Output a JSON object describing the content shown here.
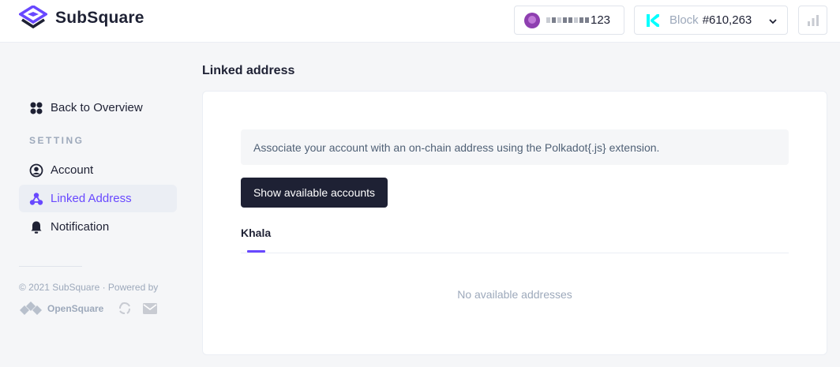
{
  "header": {
    "logo_text": "SubSquare",
    "account": {
      "address_suffix": "123"
    },
    "block": {
      "label": "Block",
      "number": "#610,263"
    }
  },
  "sidebar": {
    "back_label": "Back to Overview",
    "section_label": "SETTING",
    "items": [
      {
        "label": "Account",
        "icon": "user-circle-icon",
        "active": false
      },
      {
        "label": "Linked Address",
        "icon": "linked-nodes-icon",
        "active": true
      },
      {
        "label": "Notification",
        "icon": "bell-icon",
        "active": false
      }
    ],
    "footer_text": "© 2021 SubSquare · Powered by",
    "powered_by": "OpenSquare"
  },
  "main": {
    "title": "Linked address",
    "info_text": "Associate your account with an on-chain address using the Polkadot{.js} extension.",
    "button_label": "Show available accounts",
    "tabs": [
      {
        "label": "Khala",
        "active": true
      }
    ],
    "empty_text": "No available addresses"
  },
  "colors": {
    "accent": "#6848ff",
    "dark": "#1e2134",
    "muted": "#9da9bb",
    "khala": "#03ffff"
  }
}
